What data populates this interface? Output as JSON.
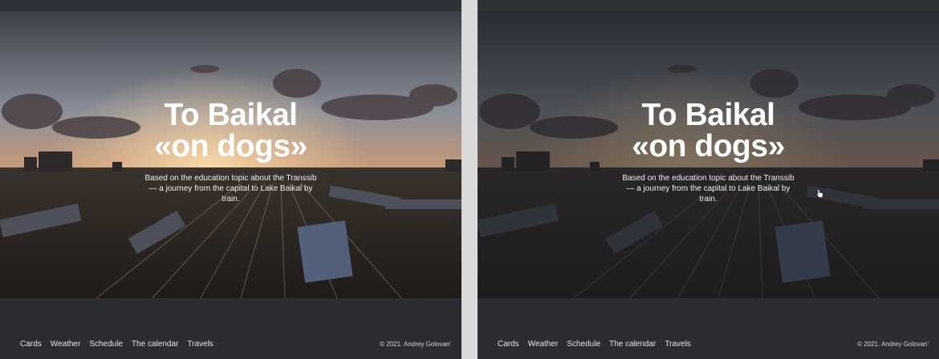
{
  "hero": {
    "title_line1": "To Baikal",
    "title_line2": "«on dogs»",
    "subtitle": "Based on the education topic about the Transsib — a journey from the capital to Lake Baikal by train."
  },
  "footer": {
    "nav": [
      "Cards",
      "Weather",
      "Schedule",
      "The calendar",
      "Travels"
    ],
    "copyright": "© 2021. Andrey Golovan'"
  },
  "colors": {
    "background": "#2b2d31",
    "text": "#ffffff",
    "sky_glow": "#e8a56a"
  },
  "icons": {
    "cursor": "pointer-hand-icon"
  }
}
